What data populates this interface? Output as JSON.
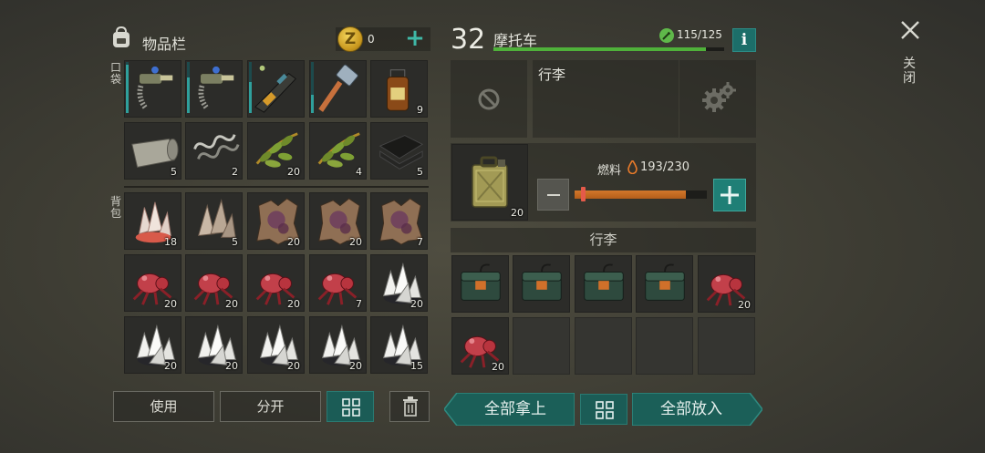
{
  "inventory": {
    "title": "物品栏",
    "coin_symbol": "Z",
    "coins": "0",
    "pocket_label": "口袋",
    "backpack_label": "背包",
    "slots": [
      {
        "item": "pipe-wrench-tool",
        "count": "",
        "durability": 0.95
      },
      {
        "item": "pipe-wrench-tool",
        "count": "",
        "durability": 0.7
      },
      {
        "item": "assault-rifle",
        "count": "",
        "durability": 0.6
      },
      {
        "item": "sledgehammer",
        "count": "",
        "durability": 0.35
      },
      {
        "item": "medicine-bottle",
        "count": "9"
      },
      {
        "item": "cloth-roll",
        "count": "5"
      },
      {
        "item": "metal-spring",
        "count": "2"
      },
      {
        "item": "plant-fiber",
        "count": "20"
      },
      {
        "item": "plant-fiber",
        "count": "4"
      },
      {
        "item": "black-leather",
        "count": "5"
      },
      {
        "item": "red-crystal",
        "count": "18"
      },
      {
        "item": "quartz-crystal",
        "count": "5"
      },
      {
        "item": "beast-hide",
        "count": "20"
      },
      {
        "item": "beast-hide",
        "count": "20"
      },
      {
        "item": "beast-hide",
        "count": "7"
      },
      {
        "item": "red-spider",
        "count": "20"
      },
      {
        "item": "red-spider",
        "count": "20"
      },
      {
        "item": "red-spider",
        "count": "20"
      },
      {
        "item": "red-spider",
        "count": "7"
      },
      {
        "item": "white-crystal-ore",
        "count": "20"
      },
      {
        "item": "white-crystal-ore",
        "count": "20"
      },
      {
        "item": "white-crystal-ore",
        "count": "20"
      },
      {
        "item": "white-crystal-ore",
        "count": "20"
      },
      {
        "item": "white-crystal-ore",
        "count": "20"
      },
      {
        "item": "white-crystal-ore",
        "count": "15"
      }
    ]
  },
  "buttons": {
    "use": "使用",
    "split": "分开",
    "take_all": "全部拿上",
    "put_all": "全部放入",
    "close": "关闭"
  },
  "vehicle": {
    "level": "32",
    "name": "摩托车",
    "durability_text": "115/125",
    "durability_fraction": 0.92,
    "trunk_title": "行李",
    "fuel_label": "燃料",
    "fuel_text": "193/230",
    "fuel_fraction": 0.84,
    "fuel_can_count": "20",
    "trunk_header": "行李",
    "trunk_slots": [
      {
        "item": "ammo-crate",
        "count": ""
      },
      {
        "item": "ammo-crate",
        "count": ""
      },
      {
        "item": "ammo-crate",
        "count": ""
      },
      {
        "item": "ammo-crate",
        "count": ""
      },
      {
        "item": "red-spider",
        "count": "20"
      },
      {
        "item": "red-spider",
        "count": "20"
      },
      {
        "item": "empty",
        "count": ""
      },
      {
        "item": "empty",
        "count": ""
      },
      {
        "item": "empty",
        "count": ""
      },
      {
        "item": "empty",
        "count": ""
      }
    ]
  },
  "icons": {
    "bag": "backpack-icon",
    "coin": "coin-icon",
    "add": "plus-icon",
    "info": "info-icon",
    "blocked": "no-entry-icon",
    "settings": "gears-icon",
    "fuel": "flame-icon",
    "durability": "wrench-icon",
    "close": "close-icon",
    "trash": "trash-icon",
    "sort": "grid-sort-icon"
  },
  "colors": {
    "accent_teal": "#1b5f58",
    "health_green": "#4fb13a",
    "fuel_orange": "#d2772b"
  }
}
